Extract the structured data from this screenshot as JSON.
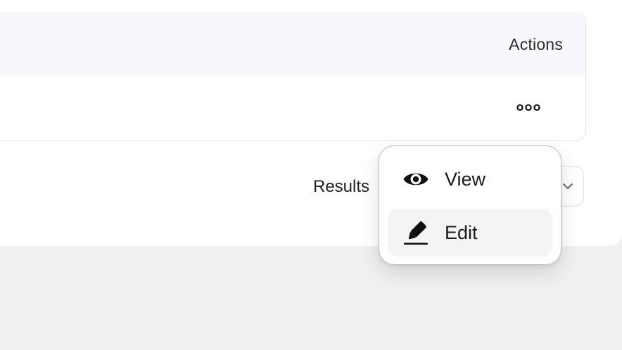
{
  "table": {
    "columns": {
      "actions": "Actions"
    }
  },
  "footer": {
    "results_label": "Results"
  },
  "row_menu": {
    "items": [
      {
        "label": "View",
        "icon": "eye-icon"
      },
      {
        "label": "Edit",
        "icon": "pen-icon"
      }
    ]
  },
  "colors": {
    "header_bg": "#f7f8fd",
    "page_bg": "#eff1f0",
    "hover_bg": "#f4f4f4"
  }
}
